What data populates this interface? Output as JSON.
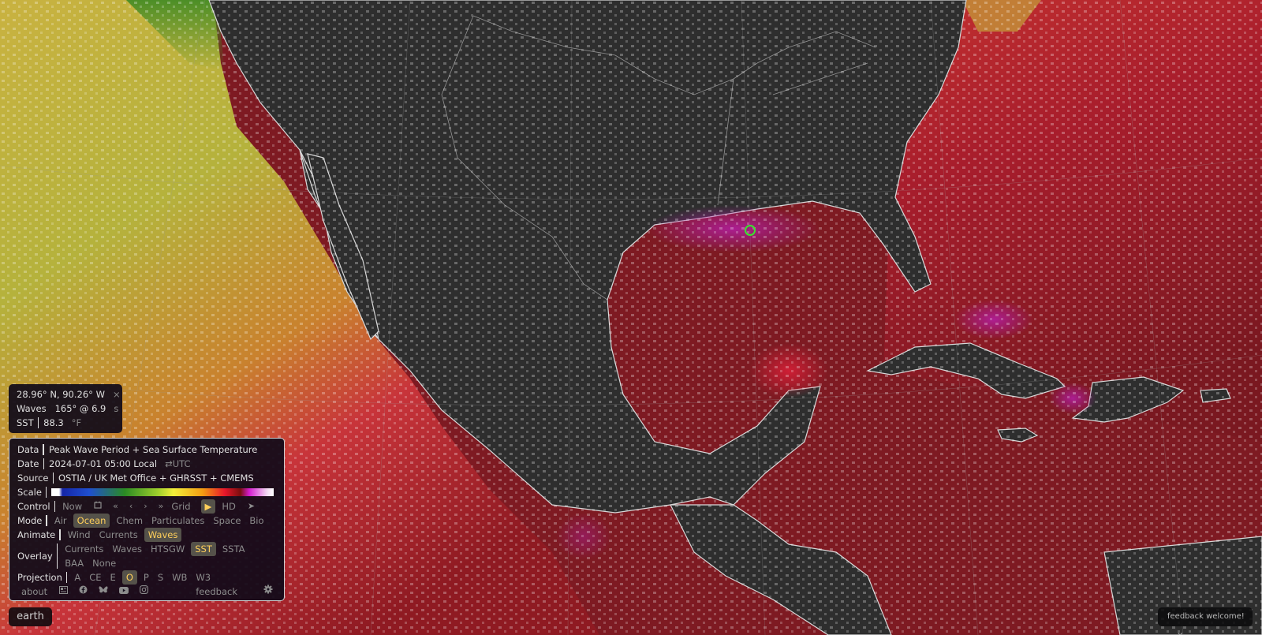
{
  "colors": {
    "land": "#2e2e2e",
    "coastline": "#d8d8d8",
    "selected_text": "#ffcf5a",
    "selected_bg": "#55524a",
    "location_marker": "#39e62e"
  },
  "location": {
    "coordinates": "28.96° N, 90.26° W",
    "close_icon": "×",
    "waves_label": "Waves",
    "waves_value": "165° @ 6.9",
    "waves_unit": "s",
    "sst_label": "SST",
    "sst_value": "88.3",
    "sst_unit": "°F"
  },
  "menu": {
    "data_label": "Data",
    "data_value": "Peak Wave Period + Sea Surface Temperature",
    "date_label": "Date",
    "date_value": "2024-07-01 05:00 Local",
    "date_toggle": "⇄UTC",
    "source_label": "Source",
    "source_value": "OSTIA / UK Met Office + GHRSST + CMEMS",
    "scale_label": "Scale",
    "control_label": "Control",
    "control": {
      "now": "Now",
      "calendar_icon": "calendar-icon",
      "rewind_fast": "«",
      "rewind": "‹",
      "forward": "›",
      "forward_fast": "»",
      "grid": "Grid",
      "play": "▶",
      "hd": "HD",
      "locate": "➤"
    },
    "mode_label": "Mode",
    "modes": [
      {
        "label": "Air",
        "selected": false
      },
      {
        "label": "Ocean",
        "selected": true
      },
      {
        "label": "Chem",
        "selected": false
      },
      {
        "label": "Particulates",
        "selected": false
      },
      {
        "label": "Space",
        "selected": false
      },
      {
        "label": "Bio",
        "selected": false
      }
    ],
    "animate_label": "Animate",
    "animate": [
      {
        "label": "Wind",
        "selected": false
      },
      {
        "label": "Currents",
        "selected": false
      },
      {
        "label": "Waves",
        "selected": true
      }
    ],
    "overlay_label": "Overlay",
    "overlays": [
      {
        "label": "Currents",
        "selected": false
      },
      {
        "label": "Waves",
        "selected": false
      },
      {
        "label": "HTSGW",
        "selected": false
      },
      {
        "label": "SST",
        "selected": true
      },
      {
        "label": "SSTA",
        "selected": false
      },
      {
        "label": "BAA",
        "selected": false
      },
      {
        "label": "None",
        "selected": false
      }
    ],
    "projection_label": "Projection",
    "projections": [
      {
        "label": "A",
        "selected": false
      },
      {
        "label": "CE",
        "selected": false
      },
      {
        "label": "E",
        "selected": false
      },
      {
        "label": "O",
        "selected": true
      },
      {
        "label": "P",
        "selected": false
      },
      {
        "label": "S",
        "selected": false
      },
      {
        "label": "WB",
        "selected": false
      },
      {
        "label": "W3",
        "selected": false
      }
    ],
    "footer": {
      "about": "about",
      "feedback": "feedback"
    }
  },
  "badge": {
    "label": "earth"
  },
  "toast": {
    "text": "feedback welcome!",
    "close": "×"
  }
}
